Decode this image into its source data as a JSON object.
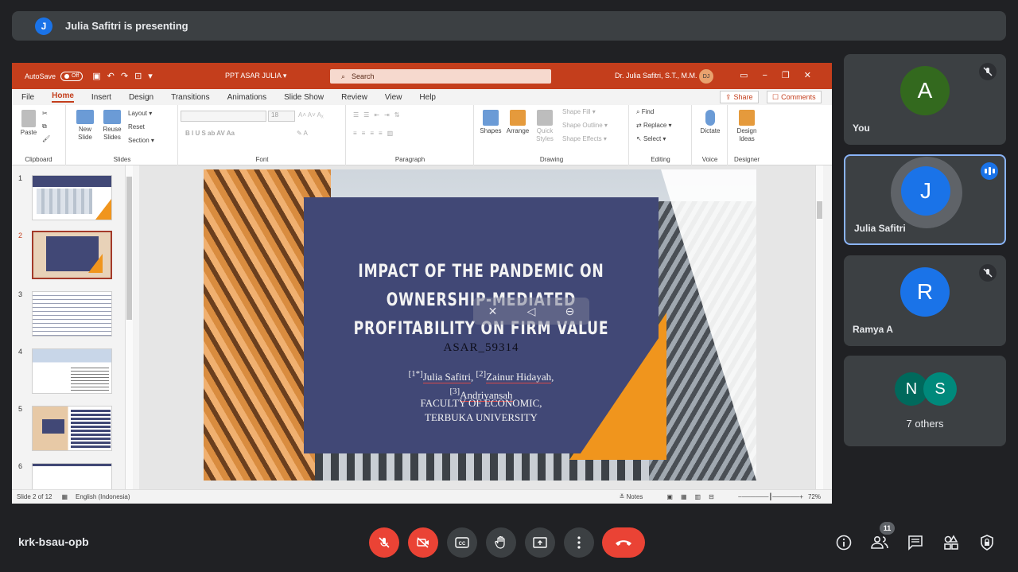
{
  "banner": {
    "avatar_letter": "J",
    "text": "Julia Safitri is presenting"
  },
  "ppt": {
    "autosave_label": "AutoSave",
    "autosave_state": "Off",
    "doc_title": "PPT ASAR JULIA  ▾",
    "search_placeholder": "Search",
    "user_name": "Dr. Julia Safitri, S.T., M.M.",
    "user_initials": "DJ",
    "menu": [
      "File",
      "Home",
      "Insert",
      "Design",
      "Transitions",
      "Animations",
      "Slide Show",
      "Review",
      "View",
      "Help"
    ],
    "active_menu": "Home",
    "share_label": "Share",
    "comments_label": "Comments",
    "ribbon": {
      "paste": "Paste",
      "new_slide": "New Slide",
      "reuse_slides": "Reuse Slides",
      "layout": "Layout ▾",
      "reset": "Reset",
      "section": "Section ▾",
      "shapes": "Shapes",
      "arrange": "Arrange",
      "quick_styles": "Quick Styles",
      "shape_fill": "Shape Fill ▾",
      "shape_outline": "Shape Outline ▾",
      "shape_effects": "Shape Effects ▾",
      "find": "Find",
      "replace": "Replace ▾",
      "select": "Select ▾",
      "dictate": "Dictate",
      "design_ideas": "Design Ideas",
      "font_size": "18",
      "groups": {
        "clipboard": "Clipboard",
        "slides": "Slides",
        "font": "Font",
        "paragraph": "Paragraph",
        "drawing": "Drawing",
        "editing": "Editing",
        "voice": "Voice",
        "designer": "Designer"
      }
    },
    "thumbnails": [
      "1",
      "2",
      "3",
      "4",
      "5",
      "6"
    ],
    "selected_thumbnail": "2",
    "slide": {
      "title_line1": "IMPACT OF THE PANDEMIC ON",
      "title_line2": "OWNERSHIP-MEDIATED",
      "title_line3": "PROFITABILITY ON FIRM VALUE",
      "code": "ASAR_59314",
      "author1_sup": "[1*]",
      "author1": "Julia Safitri",
      "author2_sup": "[2]",
      "author2": "Zainur Hidayah",
      "author3_sup": "[3]",
      "author3": "Andriyansah",
      "faculty_line1": "FACULTY OF ECONOMIC,",
      "faculty_line2": "TERBUKA UNIVERSITY"
    },
    "status": {
      "slide_count": "Slide 2 of 12",
      "language": "English (Indonesia)",
      "notes": "Notes",
      "zoom": "72%"
    }
  },
  "participants": [
    {
      "letter": "A",
      "name": "You",
      "color": "#33691e",
      "muted": true
    },
    {
      "letter": "J",
      "name": "Julia Safitri",
      "color": "#1a73e8",
      "speaking": true
    },
    {
      "letter": "R",
      "name": "Ramya A",
      "color": "#1a73e8",
      "muted": true
    }
  ],
  "others": {
    "letters": [
      "N",
      "S"
    ],
    "colors": [
      "#00695c",
      "#00897b"
    ],
    "label": "7 others"
  },
  "meeting_code": "krk-bsau-opb",
  "people_count": "11",
  "icons": [
    "mic-off-icon",
    "camera-off-icon",
    "captions-icon",
    "raise-hand-icon",
    "present-icon",
    "more-icon",
    "end-call-icon",
    "info-icon",
    "people-icon",
    "chat-icon",
    "activities-icon",
    "host-controls-icon"
  ]
}
